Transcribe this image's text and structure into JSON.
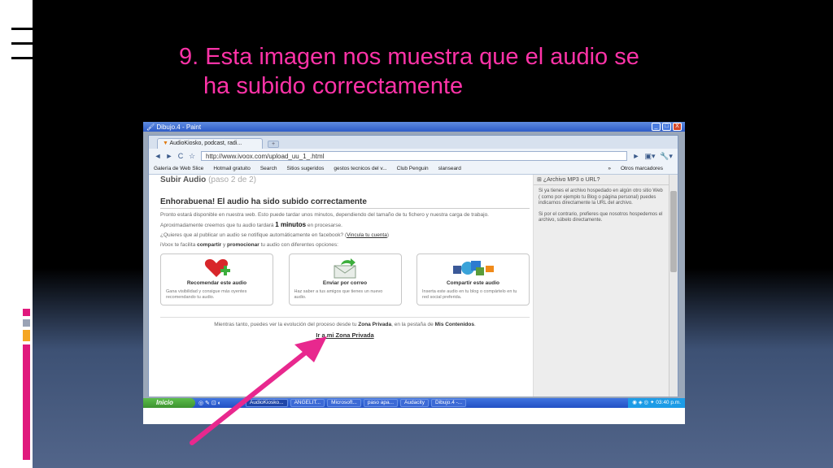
{
  "slide": {
    "title_line1": "9. Esta imagen nos muestra que el audio se",
    "title_line2": "ha subido correctamente",
    "title_color": "#ff33a8",
    "accent_colors": [
      "#e0197d",
      "#f5a623",
      "#4a6fa5"
    ]
  },
  "paint_window": {
    "title": "Dibujo.4 - Paint",
    "buttons": [
      "_",
      "□",
      "X"
    ]
  },
  "browser": {
    "tab_title": "AudioKiosko, podcast, radi...",
    "new_tab": "+",
    "url": "http://www.ivoox.com/upload_uu_1_.html",
    "nav": {
      "back": "◄",
      "forward": "►",
      "reload": "C",
      "star": "☆",
      "go": "►",
      "page_menu": "▣▾",
      "tools_menu": "🔧▾"
    },
    "bookmarks": [
      "Galería de Web Slice",
      "Hotmail gratuito",
      "Search",
      "Sitios sugeridos",
      "gestos tecnicos del v...",
      "Club Penguin",
      "slanseard"
    ],
    "bookmarks_more": "»",
    "bookmarks_other": "Otros marcadores"
  },
  "page": {
    "section_title": "Subir Audio",
    "step": "(paso 2 de 2)",
    "heading": "Enhorabuena! El audio ha sido subido correctamente",
    "para1": "Pronto estará disponible en nuestra web. Esto puede tardar unos minutos, dependiendo del tamaño de tu fichero y nuestra carga de trabajo.",
    "approx_pre": "Aproximadamente creemos que tu audio tardará",
    "approx_bold": "1 minutos",
    "approx_post": "en procesarse.",
    "facebook_pre": "¿Quieres que al publicar un audio se notifique automáticamente en facebook? (",
    "facebook_link": "Vincula tu cuenta",
    "facebook_post": ")",
    "share_pre": "iVoox te facilita",
    "share_b1": "compartir",
    "share_mid": "y",
    "share_b2": "promocionar",
    "share_post": "tu audio con diferentes opciones:",
    "cards": [
      {
        "title": "Recomendar este audio",
        "desc": "Gana visibilidad y consigue más oyentes recomendando tu audio.",
        "icon": "heart-plus-icon"
      },
      {
        "title": "Enviar por correo",
        "desc": "Haz saber a tus amigos que tienes un nuevo audio.",
        "icon": "envelope-icon"
      },
      {
        "title": "Compartir este audio",
        "desc": "Inserta este audio en tu blog o compártelo en tu red social preferida.",
        "icon": "social-icons"
      }
    ],
    "footer_pre": "Mientras tanto, puedes ver la evolución del proceso desde tu",
    "footer_b1": "Zona Privada",
    "footer_mid": ", en la pestaña de",
    "footer_b2": "Mis Contenidos",
    "footer_post": ".",
    "zona_link": "Ir a mi Zona Privada"
  },
  "sidebar": {
    "heading": "¿Archivo MP3 o URL?",
    "p1": "Si ya tienes el archivo hospedado en algún otro sitio Web ( como por ejemplo tu Blog o página personal) puedes indicarnos directamente la URL del archivo.",
    "p2": "Si por el contrario, prefieres que nosotros hospedemos el archivo, súbelo directamente."
  },
  "taskbar": {
    "start": "Inicio",
    "quicklaunch": "◎ ✎ ⊡ ◐",
    "tasks": [
      "AudioKiosko...",
      "ANGELIT...",
      "Microsoft...",
      "paso apa...",
      "Audacity",
      "Dibujo.4 -..."
    ],
    "clock": "03:40 p.m."
  }
}
